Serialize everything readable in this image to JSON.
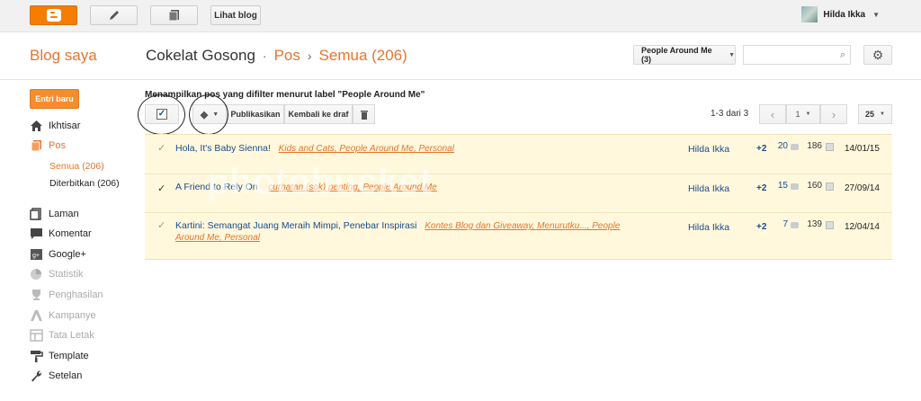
{
  "topbar": {
    "view_blog_label": "Lihat blog",
    "user_name": "Hilda Ikka"
  },
  "header": {
    "brand": "Blog saya",
    "blog_name": "Cokelat Gosong",
    "section": "Pos",
    "filter": "Semua (206)",
    "label_filter": "People Around Me (3)",
    "search_placeholder": ""
  },
  "sidebar": {
    "new_post_label": "Entri baru",
    "items": [
      {
        "label": "Ikhtisar",
        "icon": "home-icon"
      },
      {
        "label": "Pos",
        "icon": "posts-icon"
      },
      {
        "label": "Semua (206)"
      },
      {
        "label": "Diterbitkan (206)"
      },
      {
        "label": "Laman",
        "icon": "pages-icon"
      },
      {
        "label": "Komentar",
        "icon": "comments-icon"
      },
      {
        "label": "Google+",
        "icon": "google-plus-icon"
      },
      {
        "label": "Statistik",
        "icon": "stats-icon"
      },
      {
        "label": "Penghasilan",
        "icon": "trophy-icon"
      },
      {
        "label": "Kampanye",
        "icon": "campaign-icon"
      },
      {
        "label": "Tata Letak",
        "icon": "layout-icon"
      },
      {
        "label": "Template",
        "icon": "paint-roller-icon"
      },
      {
        "label": "Setelan",
        "icon": "wrench-icon"
      }
    ]
  },
  "content": {
    "filter_message": "Menampilkan pos yang difilter menurut label \"People Around Me\"",
    "publish_label": "Publikasikan",
    "revert_label": "Kembali ke draf",
    "range_text": "1-3 dari 3",
    "page_number": "1",
    "per_page": "25",
    "posts": [
      {
        "title": "Hola, It's Baby Sienna!",
        "tags": "Kids and Cats, People Around Me, Personal",
        "author": "Hilda Ikka",
        "plus": "+2",
        "comments": "20",
        "views": "186",
        "date": "14/01/15"
      },
      {
        "title": "A Friend to Rely On",
        "tags": "curhatan (sok) penting, People Around Me",
        "author": "Hilda Ikka",
        "plus": "+2",
        "comments": "15",
        "views": "160",
        "date": "27/09/14"
      },
      {
        "title": "Kartini: Semangat Juang Meraih Mimpi, Penebar Inspirasi",
        "tags": "Kontes Blog dan Giveaway, Menurutku..., People",
        "tags2": "Around Me, Personal",
        "author": "Hilda Ikka",
        "plus": "+2",
        "comments": "7",
        "views": "139",
        "date": "12/04/14"
      }
    ]
  },
  "watermark": "photobucket",
  "colors": {
    "accent": "#e8742b",
    "link": "#1a4b8c",
    "row_bg": "#fff8dd"
  }
}
